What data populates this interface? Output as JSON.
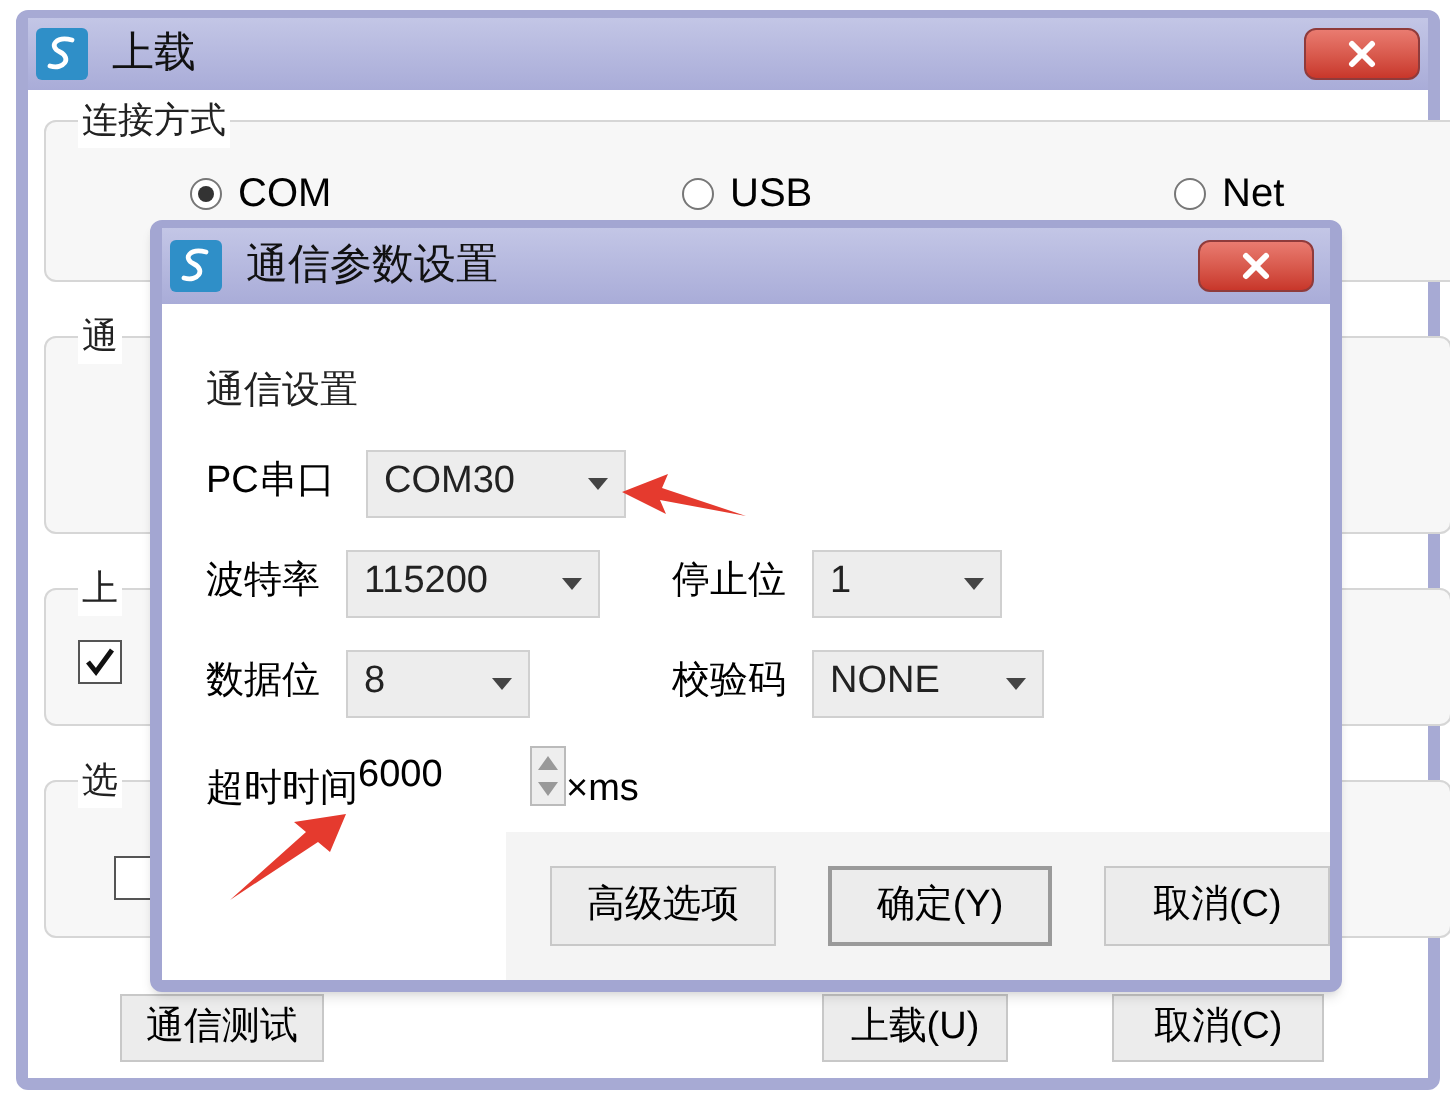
{
  "main_window": {
    "title": "上载",
    "groups": [
      {
        "label": "连接方式",
        "kind": "radios",
        "options": [
          {
            "label": "COM",
            "selected": true
          },
          {
            "label": "USB",
            "selected": false
          },
          {
            "label": "Net",
            "selected": false
          }
        ]
      },
      {
        "label": "通",
        "kind": "empty"
      },
      {
        "label": "上",
        "kind": "checkbox",
        "checked": true
      },
      {
        "label": "选",
        "kind": "checkbox",
        "checked": false
      }
    ],
    "buttons": [
      "通信测试",
      "上载(U)",
      "取消(C)"
    ]
  },
  "dialog": {
    "title": "通信参数设置",
    "section": "通信设置",
    "port": {
      "label": "PC串口",
      "value": "COM30"
    },
    "rows": [
      [
        {
          "label": "波特率",
          "value": "115200"
        },
        {
          "label": "停止位",
          "value": "1"
        }
      ],
      [
        {
          "label": "数据位",
          "value": "8"
        },
        {
          "label": "校验码",
          "value": "NONE"
        }
      ]
    ],
    "timeout": {
      "label": "超时时间",
      "value": "6000",
      "unit": "×ms"
    },
    "buttons": [
      {
        "label": "高级选项",
        "default": false
      },
      {
        "label": "确定(Y)",
        "default": true
      },
      {
        "label": "取消(C)",
        "default": false
      }
    ]
  }
}
